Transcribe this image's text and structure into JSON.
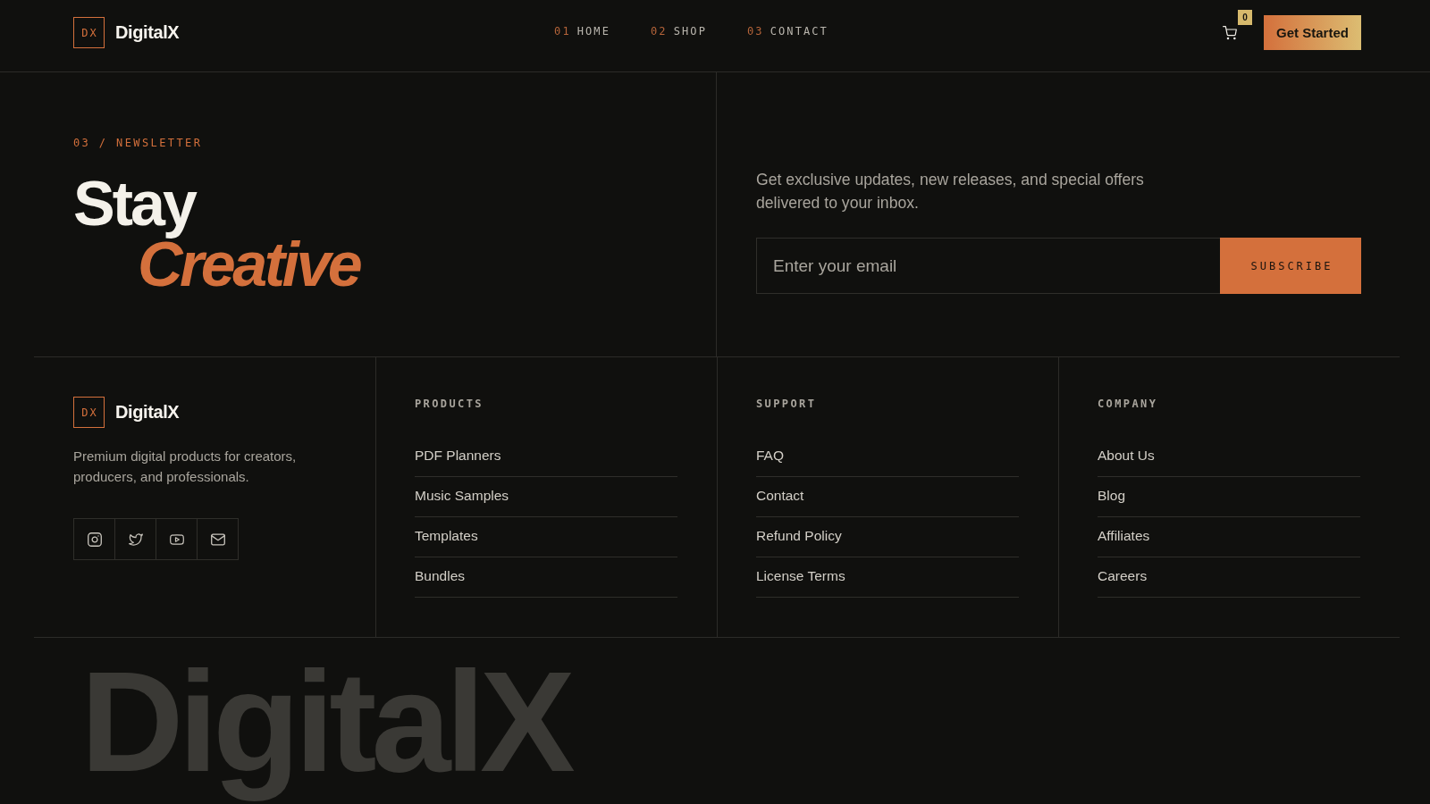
{
  "header": {
    "logo_mark": "DX",
    "brand": "DigitalX",
    "nav": [
      {
        "number": "01",
        "label": "HOME"
      },
      {
        "number": "02",
        "label": "SHOP"
      },
      {
        "number": "03",
        "label": "CONTACT"
      }
    ],
    "cart_count": "0",
    "cta": "Get Started"
  },
  "newsletter": {
    "eyebrow": "03 / NEWSLETTER",
    "title_line_1": "Stay",
    "title_line_2": "Creative",
    "description": "Get exclusive updates, new releases, and special offers delivered to your inbox.",
    "email_field": {
      "placeholder": "Enter your email"
    },
    "button": "SUBSCRIBE"
  },
  "footer": {
    "brand": {
      "logo_mark": "DX",
      "name": "DigitalX",
      "tagline": "Premium digital products for creators, producers, and professionals.",
      "social": [
        {
          "kind": "camera"
        },
        {
          "kind": "bird"
        },
        {
          "kind": "play"
        },
        {
          "kind": "mail"
        }
      ]
    },
    "columns": [
      {
        "heading": "PRODUCTS",
        "links": [
          "PDF Planners",
          "Music Samples",
          "Templates",
          "Bundles"
        ]
      },
      {
        "heading": "SUPPORT",
        "links": [
          "FAQ",
          "Contact",
          "Refund Policy",
          "License Terms"
        ]
      },
      {
        "heading": "COMPANY",
        "links": [
          "About Us",
          "Blog",
          "Affiliates",
          "Careers"
        ]
      }
    ]
  },
  "backdrop_word": "DigitalX"
}
